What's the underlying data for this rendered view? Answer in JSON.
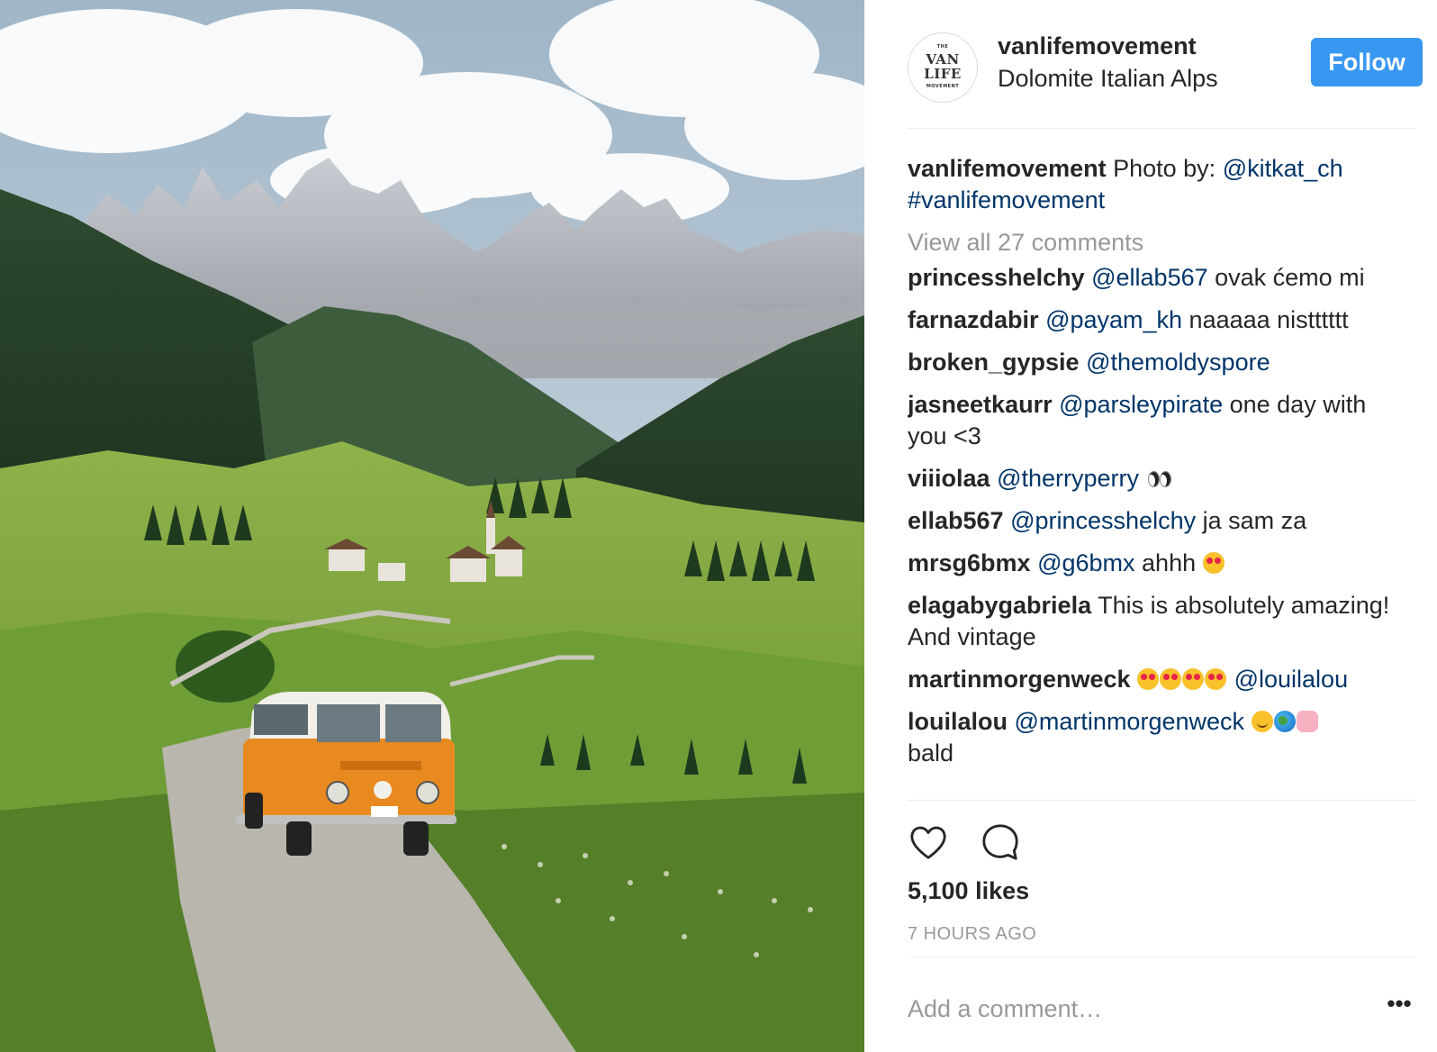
{
  "post": {
    "photo_alt": "",
    "account": {
      "username": "vanlifemovement",
      "location": "Dolomite Italian Alps",
      "avatar_text": {
        "small_top": "THE",
        "line1": "VAN",
        "line2": "LIFE",
        "small_bottom": "MOVEMENT"
      },
      "follow_label": "Follow"
    },
    "caption": {
      "username": "vanlifemovement",
      "text": "Photo by: ",
      "mention": "@kitkat_ch",
      "hashtag": "#vanlifemovement"
    },
    "view_all_label": "View all 27 comments",
    "comments": [
      {
        "user": "princesshelchy",
        "mention": "@ellab567",
        "text": " ovak ćemo mi"
      },
      {
        "user": "farnazdabir",
        "mention": "@payam_kh",
        "text": " naaaaa nistttttt"
      },
      {
        "user": "broken_gypsie",
        "mention": "@themoldyspore",
        "text": ""
      },
      {
        "user": "jasneetkaurr",
        "mention": "@parsleypirate",
        "text": " one day with you <3"
      },
      {
        "user": "viiiolaa",
        "mention": "@therryperry",
        "text": " ",
        "emoji": "eyes"
      },
      {
        "user": "ellab567",
        "mention": "@princesshelchy",
        "text": " ja sam za"
      },
      {
        "user": "mrsg6bmx",
        "mention": "@g6bmx",
        "text": " ahhh ",
        "emoji": "heart-eyes"
      },
      {
        "user": "elagabygabriela",
        "text": " This is absolutely amazing! And vintage"
      },
      {
        "user": "martinmorgenweck",
        "mention": "@louilalou",
        "emoji_before": [
          "heart-eyes",
          "heart-eyes",
          "heart-eyes",
          "heart-eyes"
        ]
      },
      {
        "user": "louilalou",
        "mention": "@martinmorgenweck",
        "emoji_after": [
          "smile",
          "globe",
          "kiss"
        ],
        "text_after": "bald"
      }
    ],
    "likes_label": "5,100 likes",
    "timestamp": "7 HOURS AGO",
    "add_comment_placeholder": "Add a comment…",
    "more_label": "•••",
    "icons": [
      "heart-icon",
      "comment-icon"
    ],
    "colors": {
      "follow_bg": "#3897f0",
      "mention": "#003569",
      "muted": "#999999",
      "text": "#262626",
      "van_orange": "#e88a1f"
    }
  }
}
